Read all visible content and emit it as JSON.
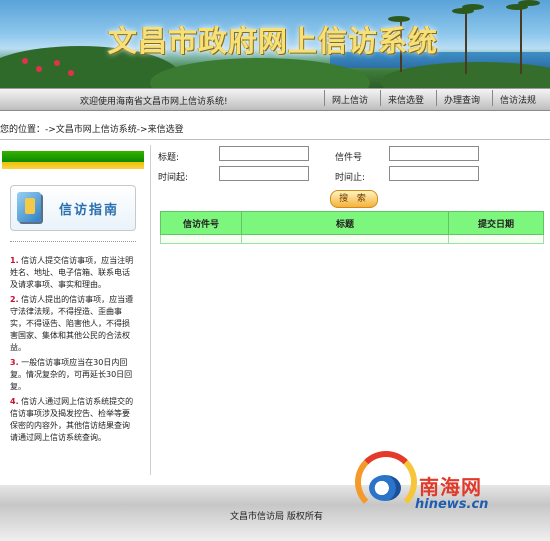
{
  "banner": {
    "title": "文昌市政府网上信访系统"
  },
  "nav": {
    "welcome": "欢迎使用海南省文昌市网上信访系统!",
    "items": [
      "网上信访",
      "来信选登",
      "办理查询",
      "信访法规"
    ]
  },
  "breadcrumb": "您的位置：->文昌市网上信访系统->来信选登",
  "sidebar": {
    "guide_title": "信访指南",
    "guide_items": [
      {
        "num": "1.",
        "text": "信访人提交信访事项，应当注明姓名、地址、电子信箱、联系电话及请求事项、事实和理由。"
      },
      {
        "num": "2.",
        "text": "信访人提出的信访事项，应当遵守法律法规，不得捏造、歪曲事实，不得诬告、陷害他人，不得损害国家、集体和其他公民的合法权益。"
      },
      {
        "num": "3.",
        "text": "一般信访事项应当在30日内回复。情况复杂的，可再延长30日回复。"
      },
      {
        "num": "4.",
        "text": "信访人通过网上信访系统提交的信访事项涉及揭发控告、检举等要保密的内容外，其他信访结果查询请通过网上信访系统查询。"
      }
    ]
  },
  "form": {
    "title_label": "标题:",
    "letter_no_label": "信件号",
    "time_from_label": "时间起:",
    "time_to_label": "时间止:",
    "title_value": "",
    "letter_no_value": "",
    "time_from_value": "",
    "time_to_value": "",
    "search_label": "搜 索"
  },
  "table": {
    "headers": [
      "信访件号",
      "标题",
      "提交日期"
    ],
    "rows": [
      [
        "",
        "",
        ""
      ]
    ]
  },
  "footer": {
    "copyright": "文昌市信访局 版权所有"
  },
  "logo": {
    "brand": "南海网",
    "domain": "hinews.cn"
  },
  "colors": {
    "table_header": "#7df67d",
    "accent_red": "#c8102e",
    "sidebar_green": "#1a9a00"
  }
}
